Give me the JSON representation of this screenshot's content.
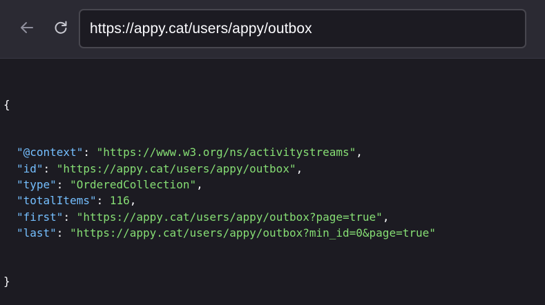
{
  "browser": {
    "url": "https://appy.cat/users/appy/outbox",
    "back_icon": "arrow-left-icon",
    "reload_icon": "reload-icon"
  },
  "json_view": {
    "open_brace": "{",
    "close_brace": "}",
    "entries": [
      {
        "key": "\"@context\"",
        "value": "\"https://www.w3.org/ns/activitystreams\"",
        "comma": ","
      },
      {
        "key": "\"id\"",
        "value": "\"https://appy.cat/users/appy/outbox\"",
        "comma": ","
      },
      {
        "key": "\"type\"",
        "value": "\"OrderedCollection\"",
        "comma": ","
      },
      {
        "key": "\"totalItems\"",
        "value": "116",
        "comma": ","
      },
      {
        "key": "\"first\"",
        "value": "\"https://appy.cat/users/appy/outbox?page=true\"",
        "comma": ","
      },
      {
        "key": "\"last\"",
        "value": "\"https://appy.cat/users/appy/outbox?min_id=0&page=true\"",
        "comma": ""
      }
    ]
  },
  "colors": {
    "key": "#75bfff",
    "string": "#86de74",
    "background": "#1c1b22",
    "toolbar": "#2b2a33"
  }
}
